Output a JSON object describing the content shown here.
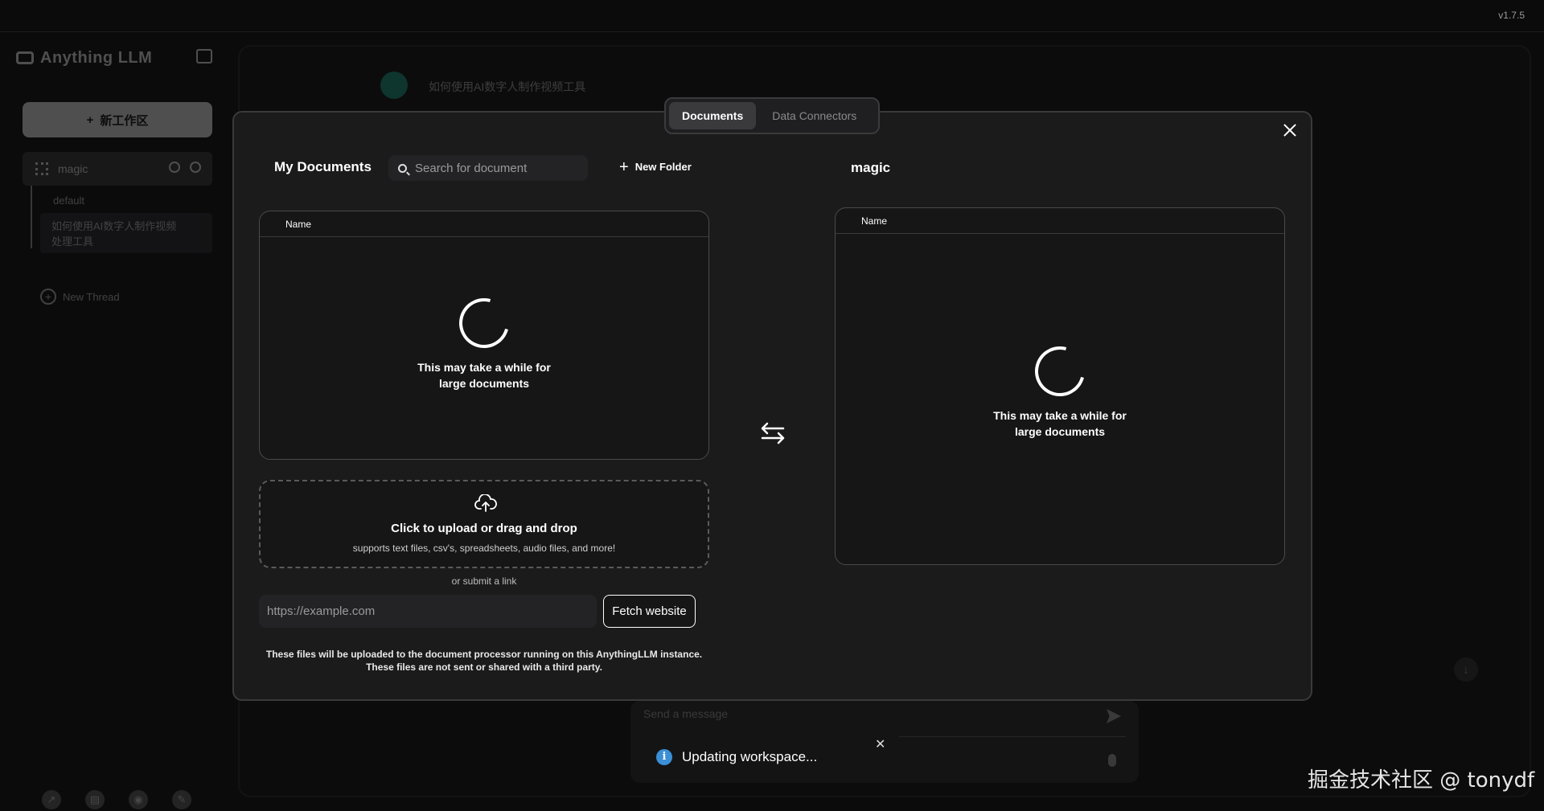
{
  "app": {
    "version": "v1.7.5",
    "logo_text": "Anything LLM"
  },
  "sidebar": {
    "new_workspace_label": "新工作区",
    "workspace_name": "magic",
    "threads": [
      "default",
      "如何使用AI数字人制作视频",
      "处理工具"
    ],
    "new_thread_label": "New Thread",
    "footer_icons": [
      "community-icon",
      "docs-icon",
      "discord-icon",
      "settings-icon"
    ]
  },
  "chat": {
    "title": "如何使用AI数字人制作视频工具",
    "composer_placeholder": "Send a message"
  },
  "modal": {
    "tabs": [
      {
        "label": "Documents",
        "active": true
      },
      {
        "label": "Data Connectors",
        "active": false
      }
    ],
    "my_documents_title": "My Documents",
    "search_placeholder": "Search for document",
    "new_folder_label": "New Folder",
    "workspace_title": "magic",
    "left_table_header": "Name",
    "right_table_header": "Name",
    "loading_line1": "This may take a while for",
    "loading_line2": "large documents",
    "upload_title": "Click to upload or drag and drop",
    "upload_sub": "supports text files, csv's, spreadsheets, audio files, and more!",
    "or_link": "or submit a link",
    "url_placeholder": "https://example.com",
    "fetch_label": "Fetch website",
    "disclaimer_line1": "These files will be uploaded to the document processor running on this AnythingLLM instance.",
    "disclaimer_line2": "These files are not sent or shared with a third party."
  },
  "toast": {
    "text": "Updating workspace..."
  },
  "watermark": "掘金技术社区 @ tonydf"
}
